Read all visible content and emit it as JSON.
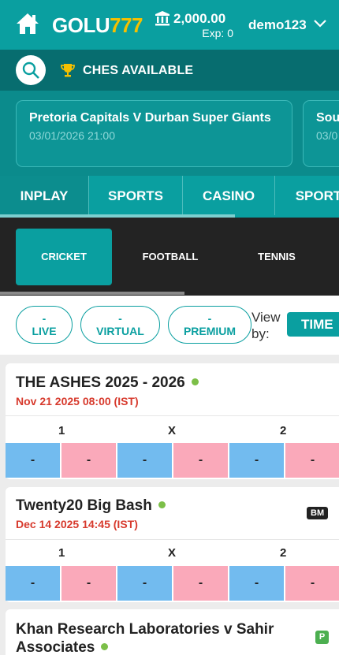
{
  "header": {
    "logo_white": "GOLU",
    "logo_yellow": "777",
    "balance": "2,000.00",
    "exposure": "Exp: 0",
    "username": "demo123",
    "colors": {
      "primary": "#0a9fa0",
      "dark": "#076d6f",
      "logo_accent": "#f5c000"
    }
  },
  "search": {
    "matches_label": "CHES AVAILABLE"
  },
  "featured": [
    {
      "title": "Pretoria Capitals V Durban Super Giants",
      "datetime": "03/01/2026 21:00"
    },
    {
      "title": "Sou",
      "datetime": "03/0"
    }
  ],
  "main_tabs": [
    "INPLAY",
    "SPORTS",
    "CASINO",
    "SPORT"
  ],
  "sport_tabs": [
    "CRICKET",
    "FOOTBALL",
    "TENNIS"
  ],
  "filters": {
    "pills": [
      {
        "count": "-",
        "label": "LIVE"
      },
      {
        "count": "-",
        "label": "VIRTUAL"
      },
      {
        "count": "-",
        "label": "PREMIUM"
      }
    ],
    "view_by": "View by:",
    "time_button": "TIME"
  },
  "matches": [
    {
      "title": "THE ASHES 2025 - 2026",
      "date": "Nov 21 2025 08:00 (IST)",
      "columns": [
        "1",
        "X",
        "2"
      ],
      "odds": [
        "-",
        "-",
        "-",
        "-",
        "-",
        "-"
      ]
    },
    {
      "title": "Twenty20 Big Bash",
      "date": "Dec 14 2025 14:45 (IST)",
      "badge": "BM",
      "columns": [
        "1",
        "X",
        "2"
      ],
      "odds": [
        "-",
        "-",
        "-",
        "-",
        "-",
        "-"
      ]
    },
    {
      "title_line1": "Khan Research Laboratories v Sahir",
      "title_line2": "Associates",
      "badge": "P"
    }
  ],
  "odds_colors": {
    "back": "#72bbef",
    "lay": "#faa9ba"
  }
}
